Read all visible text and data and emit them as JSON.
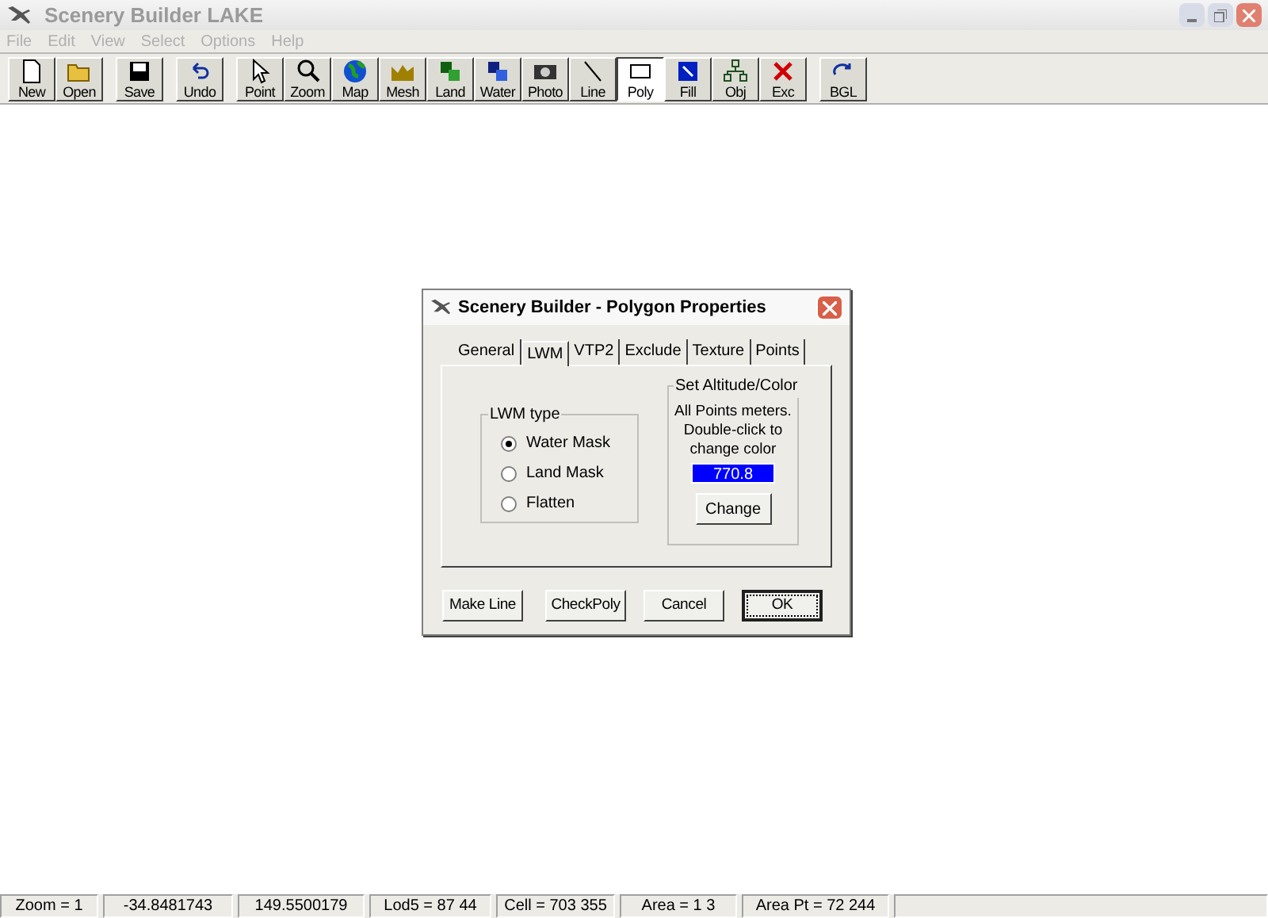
{
  "window": {
    "title": "Scenery Builder  LAKE"
  },
  "menu": [
    {
      "label": "File",
      "disabled": true
    },
    {
      "label": "Edit",
      "disabled": true
    },
    {
      "label": "View",
      "disabled": true
    },
    {
      "label": "Select",
      "disabled": true
    },
    {
      "label": "Options",
      "disabled": true
    },
    {
      "label": "Help",
      "disabled": true
    }
  ],
  "toolbar": [
    {
      "label": "New",
      "kind": "new",
      "selected": false
    },
    {
      "label": "Open",
      "kind": "open",
      "selected": false
    },
    {
      "label": "Save",
      "kind": "save",
      "selected": false
    },
    {
      "label": "Undo",
      "kind": "undo",
      "selected": false
    },
    {
      "label": "Point",
      "kind": "point",
      "selected": false
    },
    {
      "label": "Zoom",
      "kind": "zoom",
      "selected": false
    },
    {
      "label": "Map",
      "kind": "map",
      "selected": false
    },
    {
      "label": "Mesh",
      "kind": "mesh",
      "selected": false
    },
    {
      "label": "Land",
      "kind": "land",
      "selected": false
    },
    {
      "label": "Water",
      "kind": "water",
      "selected": false
    },
    {
      "label": "Photo",
      "kind": "photo",
      "selected": false
    },
    {
      "label": "Line",
      "kind": "line",
      "selected": false
    },
    {
      "label": "Poly",
      "kind": "poly",
      "selected": true
    },
    {
      "label": "Fill",
      "kind": "fill",
      "selected": false
    },
    {
      "label": "Obj",
      "kind": "obj",
      "selected": false
    },
    {
      "label": "Exc",
      "kind": "exc",
      "selected": false
    },
    {
      "label": "BGL",
      "kind": "bgl",
      "selected": false
    }
  ],
  "dialog": {
    "title": "Scenery Builder - Polygon Properties",
    "tabs": [
      {
        "label": "General",
        "selected": false
      },
      {
        "label": "LWM",
        "selected": true
      },
      {
        "label": "VTP2",
        "selected": false
      },
      {
        "label": "Exclude",
        "selected": false
      },
      {
        "label": "Texture",
        "selected": false
      },
      {
        "label": "Points",
        "selected": false
      }
    ],
    "lwm_type": {
      "label": "LWM type",
      "options": [
        {
          "label": "Water Mask",
          "selected": true
        },
        {
          "label": "Land Mask",
          "selected": false
        },
        {
          "label": "Flatten",
          "selected": false
        }
      ]
    },
    "altitude": {
      "label": "Set Altitude/Color",
      "note": "All Points meters. Double-click to change color",
      "value": "770.8",
      "color": "#0000ff",
      "button": "Change"
    },
    "buttons": [
      {
        "label": "Make Line",
        "default": false
      },
      {
        "label": "CheckPoly",
        "default": false
      },
      {
        "label": "Cancel",
        "default": false
      },
      {
        "label": "OK",
        "default": true
      }
    ]
  },
  "status_bar": [
    "Zoom = 1",
    "-34.8481743",
    "149.5500179",
    "Lod5 = 87 44",
    "Cell = 703 355",
    "Area = 1 3",
    "Area Pt = 72 244"
  ]
}
